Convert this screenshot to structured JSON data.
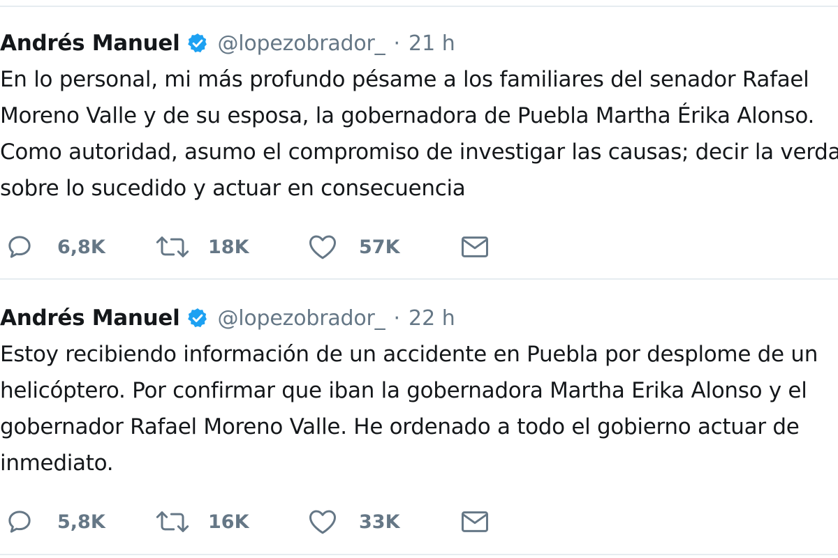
{
  "tweets": [
    {
      "author": "Andrés Manuel",
      "handle": "@lopezobrador_",
      "separator": "·",
      "time": "21 h",
      "lines": [
        "En lo personal, mi más profundo pésame a los familiares del senador Rafael",
        "Moreno Valle y de su esposa, la gobernadora de Puebla Martha Érika Alonso.",
        "Como autoridad, asumo el compromiso de investigar las causas; decir la verdad",
        "sobre lo sucedido y actuar en consecuencia"
      ],
      "replies": "6,8K",
      "retweets": "18K",
      "likes": "57K"
    },
    {
      "author": "Andrés Manuel",
      "handle": "@lopezobrador_",
      "separator": "·",
      "time": "22 h",
      "lines": [
        "Estoy recibiendo información de un accidente en Puebla por desplome de un",
        "helicóptero. Por confirmar que iban la gobernadora Martha Erika Alonso y el",
        "gobernador Rafael Moreno Valle. He ordenado a todo el gobierno actuar de",
        "inmediato."
      ],
      "replies": "5,8K",
      "retweets": "16K",
      "likes": "33K"
    }
  ],
  "icons": {
    "reply": "speech-bubble-icon",
    "retweet": "retweet-arrows-icon",
    "like": "heart-icon",
    "dm": "envelope-icon",
    "verified": "verified-badge-icon"
  },
  "colors": {
    "verified_blue": "#1da1f2",
    "secondary_text": "#657786",
    "primary_text": "#14171a"
  }
}
